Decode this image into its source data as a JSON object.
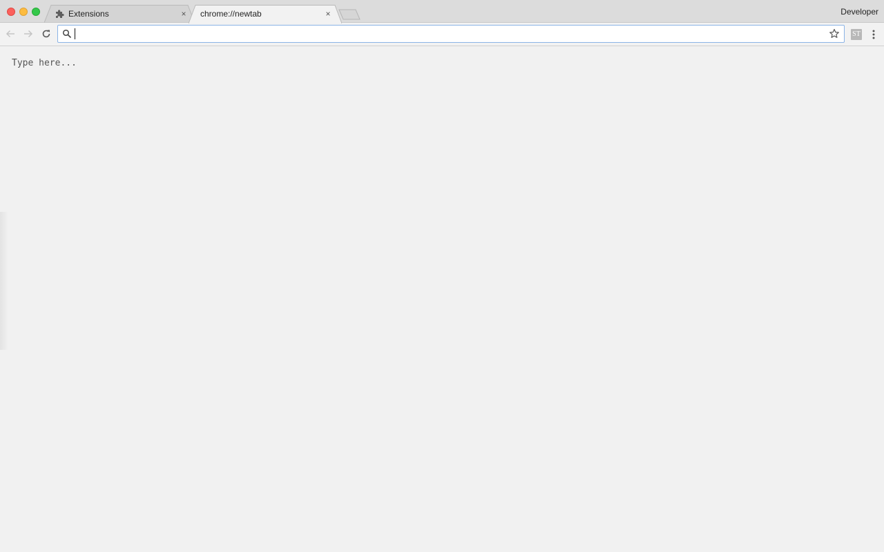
{
  "tabs": [
    {
      "title": "Extensions",
      "icon": "puzzle-piece-icon",
      "close_glyph": "×",
      "active": false
    },
    {
      "title": "chrome://newtab",
      "icon": "",
      "close_glyph": "×",
      "active": true
    }
  ],
  "profile": {
    "name": "Developer"
  },
  "toolbar": {
    "omnibox_value": "",
    "extension_label": "ST"
  },
  "content": {
    "text": "Type here..."
  },
  "colors": {
    "tabstrip_bg": "#dcdcdc",
    "content_bg": "#f1f1f1",
    "omnibox_focus_border": "#8ab3e6",
    "traffic_close": "#fc605c",
    "traffic_minimize": "#fdbc40",
    "traffic_maximize": "#34c84a"
  }
}
